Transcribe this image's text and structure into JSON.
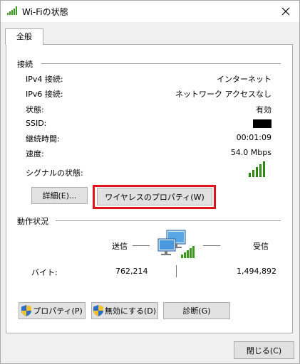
{
  "window": {
    "title": "Wi-Fiの状態",
    "close_glyph": "✕"
  },
  "tab": {
    "label": "全般"
  },
  "connection": {
    "group_label": "接続",
    "rows": [
      {
        "label": "IPv4 接続:",
        "value": "インターネット"
      },
      {
        "label": "IPv6 接続:",
        "value": "ネットワーク アクセスなし"
      },
      {
        "label": "状態:",
        "value": "有効"
      },
      {
        "label": "SSID:",
        "value": ""
      },
      {
        "label": "継続時間:",
        "value": "00:01:09"
      },
      {
        "label": "速度:",
        "value": "54.0 Mbps"
      }
    ],
    "signal_label": "シグナルの状態:",
    "signal_level": 5,
    "signal_max": 5
  },
  "buttons": {
    "details": "詳細(E)...",
    "wireless_properties": "ワイヤレスのプロパティ(W)",
    "properties": "プロパティ(P)",
    "disable": "無効にする(D)",
    "diagnose": "診断(G)",
    "close": "閉じる(C)"
  },
  "activity": {
    "group_label": "動作状況",
    "sent_label": "送信",
    "received_label": "受信",
    "bytes_label": "バイト:",
    "sent_bytes": "762,214",
    "received_bytes": "1,494,892"
  },
  "colors": {
    "highlight": "#e0151b",
    "signal_green": "#3a9a1c",
    "shield_blue": "#2d6fc4",
    "shield_yellow": "#f2c230"
  }
}
